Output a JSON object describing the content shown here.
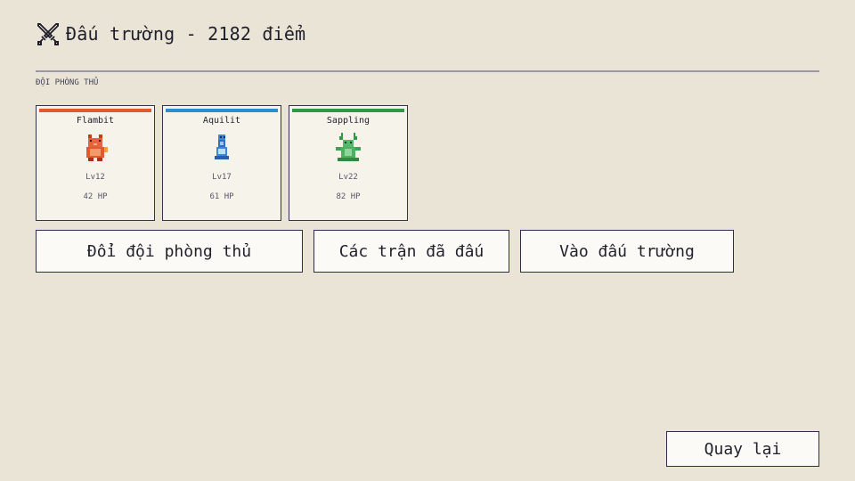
{
  "header": {
    "title": "Đấu trường - 2182 điểm",
    "icon": "crossed-swords-icon"
  },
  "team": {
    "label": "ĐỘI PHÒNG THỦ",
    "pets": [
      {
        "name": "Flambit",
        "level": "Lv12",
        "hp": "42 HP",
        "color": "#e05a2b",
        "sprite": "flambit-sprite"
      },
      {
        "name": "Aquilit",
        "level": "Lv17",
        "hp": "61 HP",
        "color": "#2a8fd0",
        "sprite": "aquilit-sprite"
      },
      {
        "name": "Sappling",
        "level": "Lv22",
        "hp": "82 HP",
        "color": "#2f9a46",
        "sprite": "sappling-sprite"
      }
    ]
  },
  "actions": {
    "swap_team": "Đổi đội phòng thủ",
    "history": "Các trận đã đấu",
    "enter_arena": "Vào đấu trường"
  },
  "back_button": "Quay lại",
  "colors": {
    "background": "#e9e4d6",
    "card": "#f6f3ea",
    "border": "#2e2e4a"
  }
}
